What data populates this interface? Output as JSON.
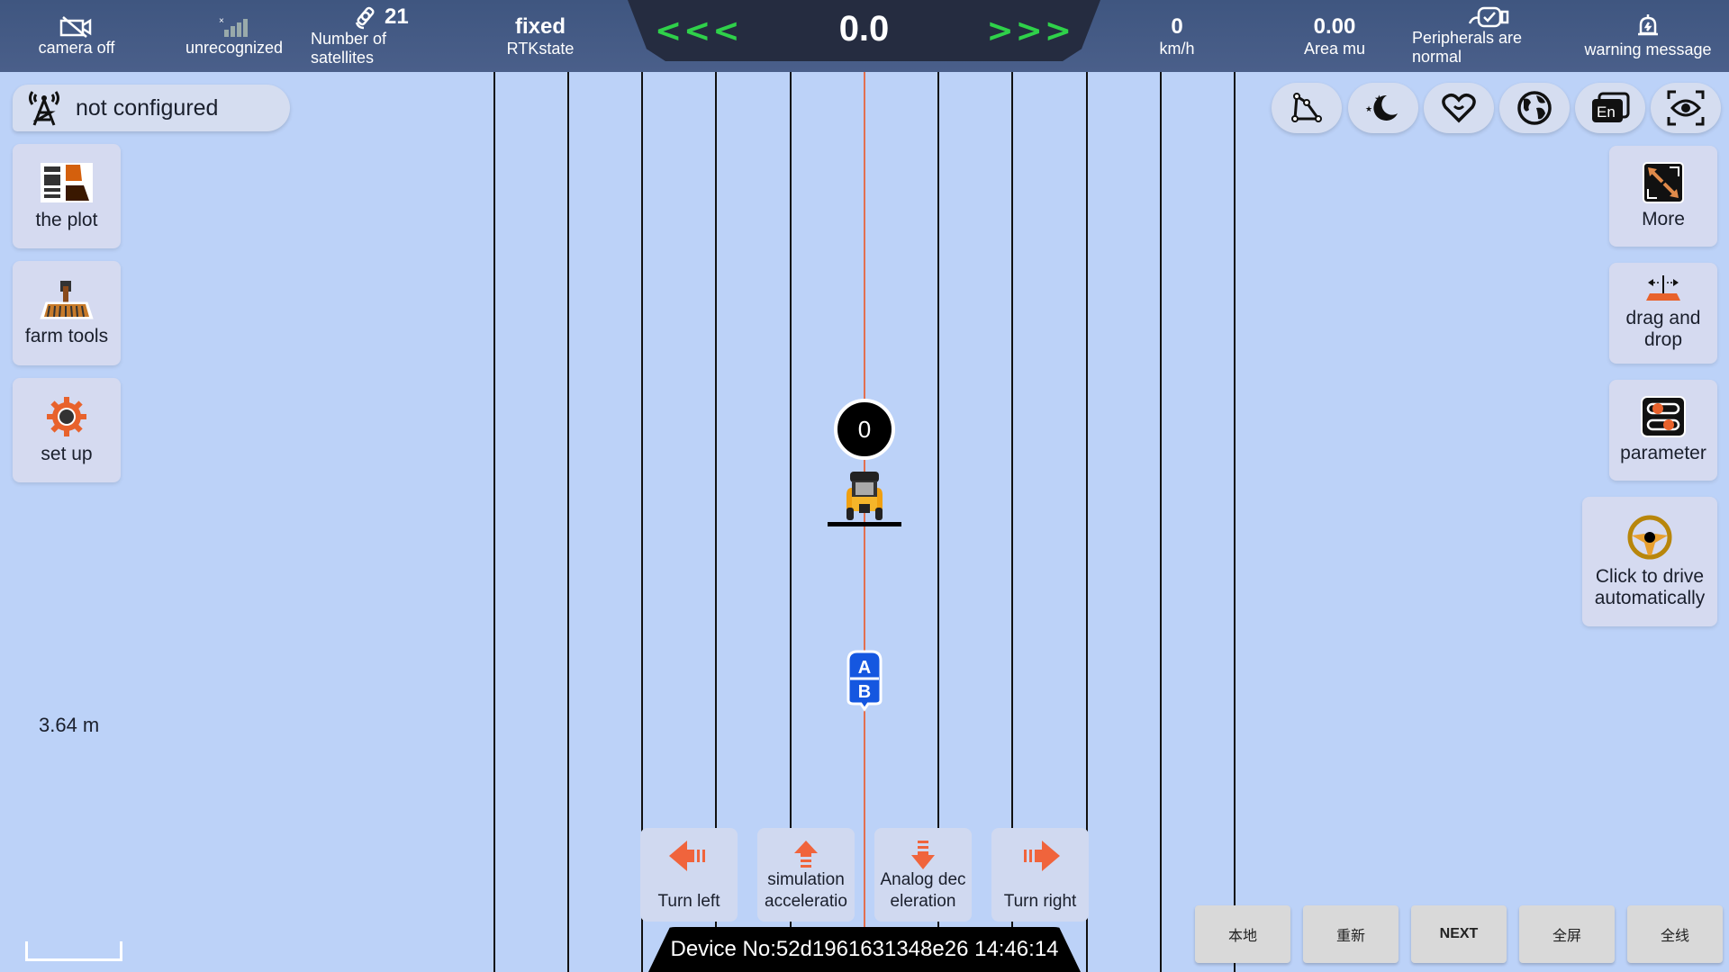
{
  "topbar": {
    "camera": {
      "icon": "camera-off-icon",
      "label": "camera off"
    },
    "signal": {
      "icon": "signal-icon",
      "label": "unrecognized"
    },
    "satellites": {
      "icon": "satellite-icon",
      "value": "21",
      "label_line1": "Number of",
      "label_line2": "satellites"
    },
    "rtk": {
      "value": "fixed",
      "label": "RTKstate"
    },
    "deviation": {
      "value": "0.0",
      "left_arrows": "<<<",
      "right_arrows": ">>>"
    },
    "speed": {
      "value": "0",
      "label": "km/h"
    },
    "area": {
      "value": "0.00",
      "label": "Area mu"
    },
    "peripherals": {
      "icon": "peripheral-check-icon",
      "label_line1": "Peripherals are",
      "label_line2": "normal"
    },
    "warning": {
      "icon": "bell-icon",
      "label": "warning message"
    }
  },
  "left": {
    "base_station": {
      "icon": "radio-tower-icon",
      "label": "not configured"
    },
    "tiles": [
      {
        "icon": "plot-icon",
        "label": "the plot"
      },
      {
        "icon": "farm-tool-icon",
        "label": "farm tools"
      },
      {
        "icon": "gear-icon",
        "label": "set up"
      }
    ],
    "scale": "3.64 m"
  },
  "right": {
    "round_buttons": [
      {
        "icon": "measure-polygon-icon"
      },
      {
        "icon": "night-mode-icon"
      },
      {
        "icon": "heart-icon"
      },
      {
        "icon": "globe-icon"
      },
      {
        "icon": "language-en-icon",
        "text": "En"
      },
      {
        "icon": "view-eye-icon"
      }
    ],
    "tiles": [
      {
        "icon": "expand-icon",
        "label": "More"
      },
      {
        "icon": "drag-implement-icon",
        "label_line1": "drag and",
        "label_line2": "drop"
      },
      {
        "icon": "sliders-icon",
        "label": "parameter"
      },
      {
        "icon": "steering-wheel-icon",
        "label_line1": "Click to drive",
        "label_line2": "automatically"
      }
    ]
  },
  "map": {
    "tractor_bubble": "0",
    "ab_marker": {
      "a": "A",
      "b": "B"
    }
  },
  "controls": [
    {
      "icon": "arrow-left-icon",
      "label_line1": "Turn left",
      "label_line2": ""
    },
    {
      "icon": "arrow-up-icon",
      "label_line1": "simulation",
      "label_line2": "acceleratio"
    },
    {
      "icon": "arrow-down-icon",
      "label_line1": "Analog dec",
      "label_line2": "eleration"
    },
    {
      "icon": "arrow-right-icon",
      "label_line1": "Turn right",
      "label_line2": ""
    }
  ],
  "device": {
    "text": "Device No:52d1961631348e26  14:46:14"
  },
  "bottom_buttons": [
    "本地",
    "重新",
    "NEXT",
    "全屏",
    "全线"
  ],
  "colors": {
    "accent_orange": "#e8622c",
    "green_arrows": "#2fd14a",
    "topbar": "#44597f",
    "field": "#bcd2f8"
  }
}
